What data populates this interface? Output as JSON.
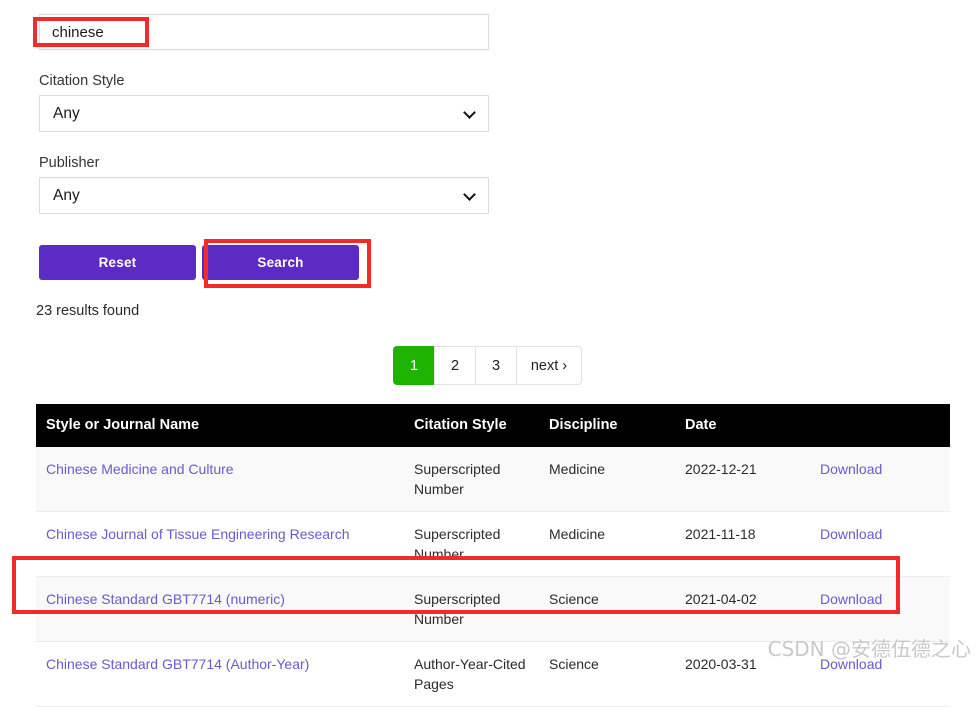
{
  "search_form": {
    "query_input": {
      "value": "chinese",
      "placeholder": ""
    },
    "citation_style": {
      "label": "Citation Style",
      "value": "Any"
    },
    "publisher": {
      "label": "Publisher",
      "value": "Any"
    },
    "reset_label": "Reset",
    "search_label": "Search"
  },
  "results": {
    "count_text": "23 results found",
    "pagination": [
      {
        "label": "1",
        "active": true
      },
      {
        "label": "2",
        "active": false
      },
      {
        "label": "3",
        "active": false
      },
      {
        "label": "next ›",
        "active": false
      }
    ],
    "columns": [
      "Style or Journal Name",
      "Citation Style",
      "Discipline",
      "Date",
      ""
    ],
    "download_label": "Download",
    "rows": [
      {
        "name": "Chinese Medicine and Culture",
        "citation_style": "Superscripted Number",
        "discipline": "Medicine",
        "date": "2022-12-21",
        "download": "Download"
      },
      {
        "name": "Chinese Journal of Tissue Engineering Research",
        "citation_style": "Superscripted Number",
        "discipline": "Medicine",
        "date": "2021-11-18",
        "download": "Download"
      },
      {
        "name": "Chinese Standard GBT7714 (numeric)",
        "citation_style": "Superscripted Number",
        "discipline": "Science",
        "date": "2021-04-02",
        "download": "Download"
      },
      {
        "name": "Chinese Standard GBT7714 (Author-Year)",
        "citation_style": "Author-Year-Cited Pages",
        "discipline": "Science",
        "date": "2020-03-31",
        "download": "Download"
      }
    ]
  },
  "watermark": {
    "text": "CSDN @安德伍德之心"
  },
  "colors": {
    "button_purple": "#5b2bc4",
    "pagination_active_green": "#1eb300",
    "link_purple": "#6a5acd",
    "annotation_red": "#f32a2a",
    "table_header_black": "#000000"
  }
}
